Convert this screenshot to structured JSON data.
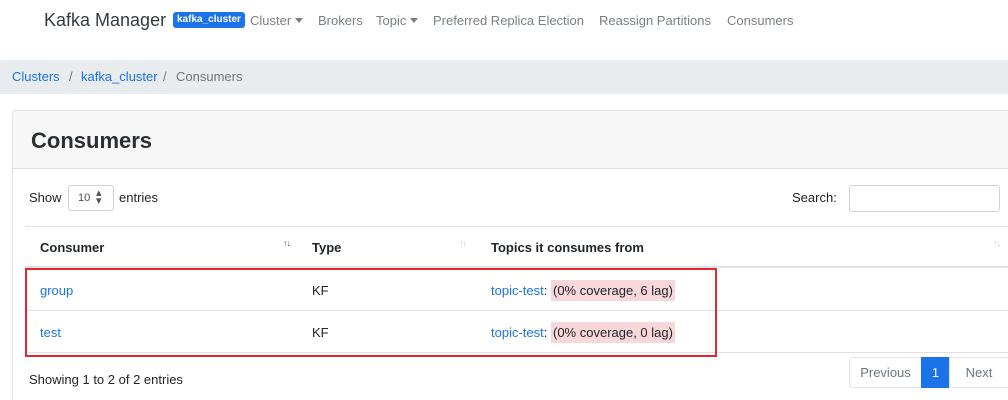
{
  "navbar": {
    "brand": "Kafka Manager",
    "cluster_badge": "kafka_cluster",
    "items": [
      {
        "label": "Cluster",
        "dropdown": true
      },
      {
        "label": "Brokers",
        "dropdown": false
      },
      {
        "label": "Topic",
        "dropdown": true
      },
      {
        "label": "Preferred Replica Election",
        "dropdown": false
      },
      {
        "label": "Reassign Partitions",
        "dropdown": false
      },
      {
        "label": "Consumers",
        "dropdown": false
      }
    ]
  },
  "breadcrumb": {
    "items": [
      "Clusters",
      "kafka_cluster",
      "Consumers"
    ],
    "separator": "/"
  },
  "card": {
    "title": "Consumers",
    "length": {
      "prefix": "Show",
      "value": "10",
      "suffix": "entries"
    },
    "search_label": "Search:",
    "search_value": "",
    "columns": [
      "Consumer",
      "Type",
      "Topics it consumes from"
    ],
    "rows": [
      {
        "consumer": "group",
        "type": "KF",
        "topic": "topic-test",
        "colon": ":",
        "coverage": "(0% coverage, 6 lag)"
      },
      {
        "consumer": "test",
        "type": "KF",
        "topic": "topic-test",
        "colon": ":",
        "coverage": "(0% coverage, 0 lag)"
      }
    ],
    "info": "Showing 1 to 2 of 2 entries",
    "pagination": {
      "previous": "Previous",
      "current": "1",
      "next": "Next"
    }
  },
  "colors": {
    "link": "#1a73e8",
    "badge": "#1a73e8",
    "coverage_bg": "#f8d7da",
    "highlight_border": "#e0282e",
    "breadcrumb_bg": "#e9ecef"
  }
}
